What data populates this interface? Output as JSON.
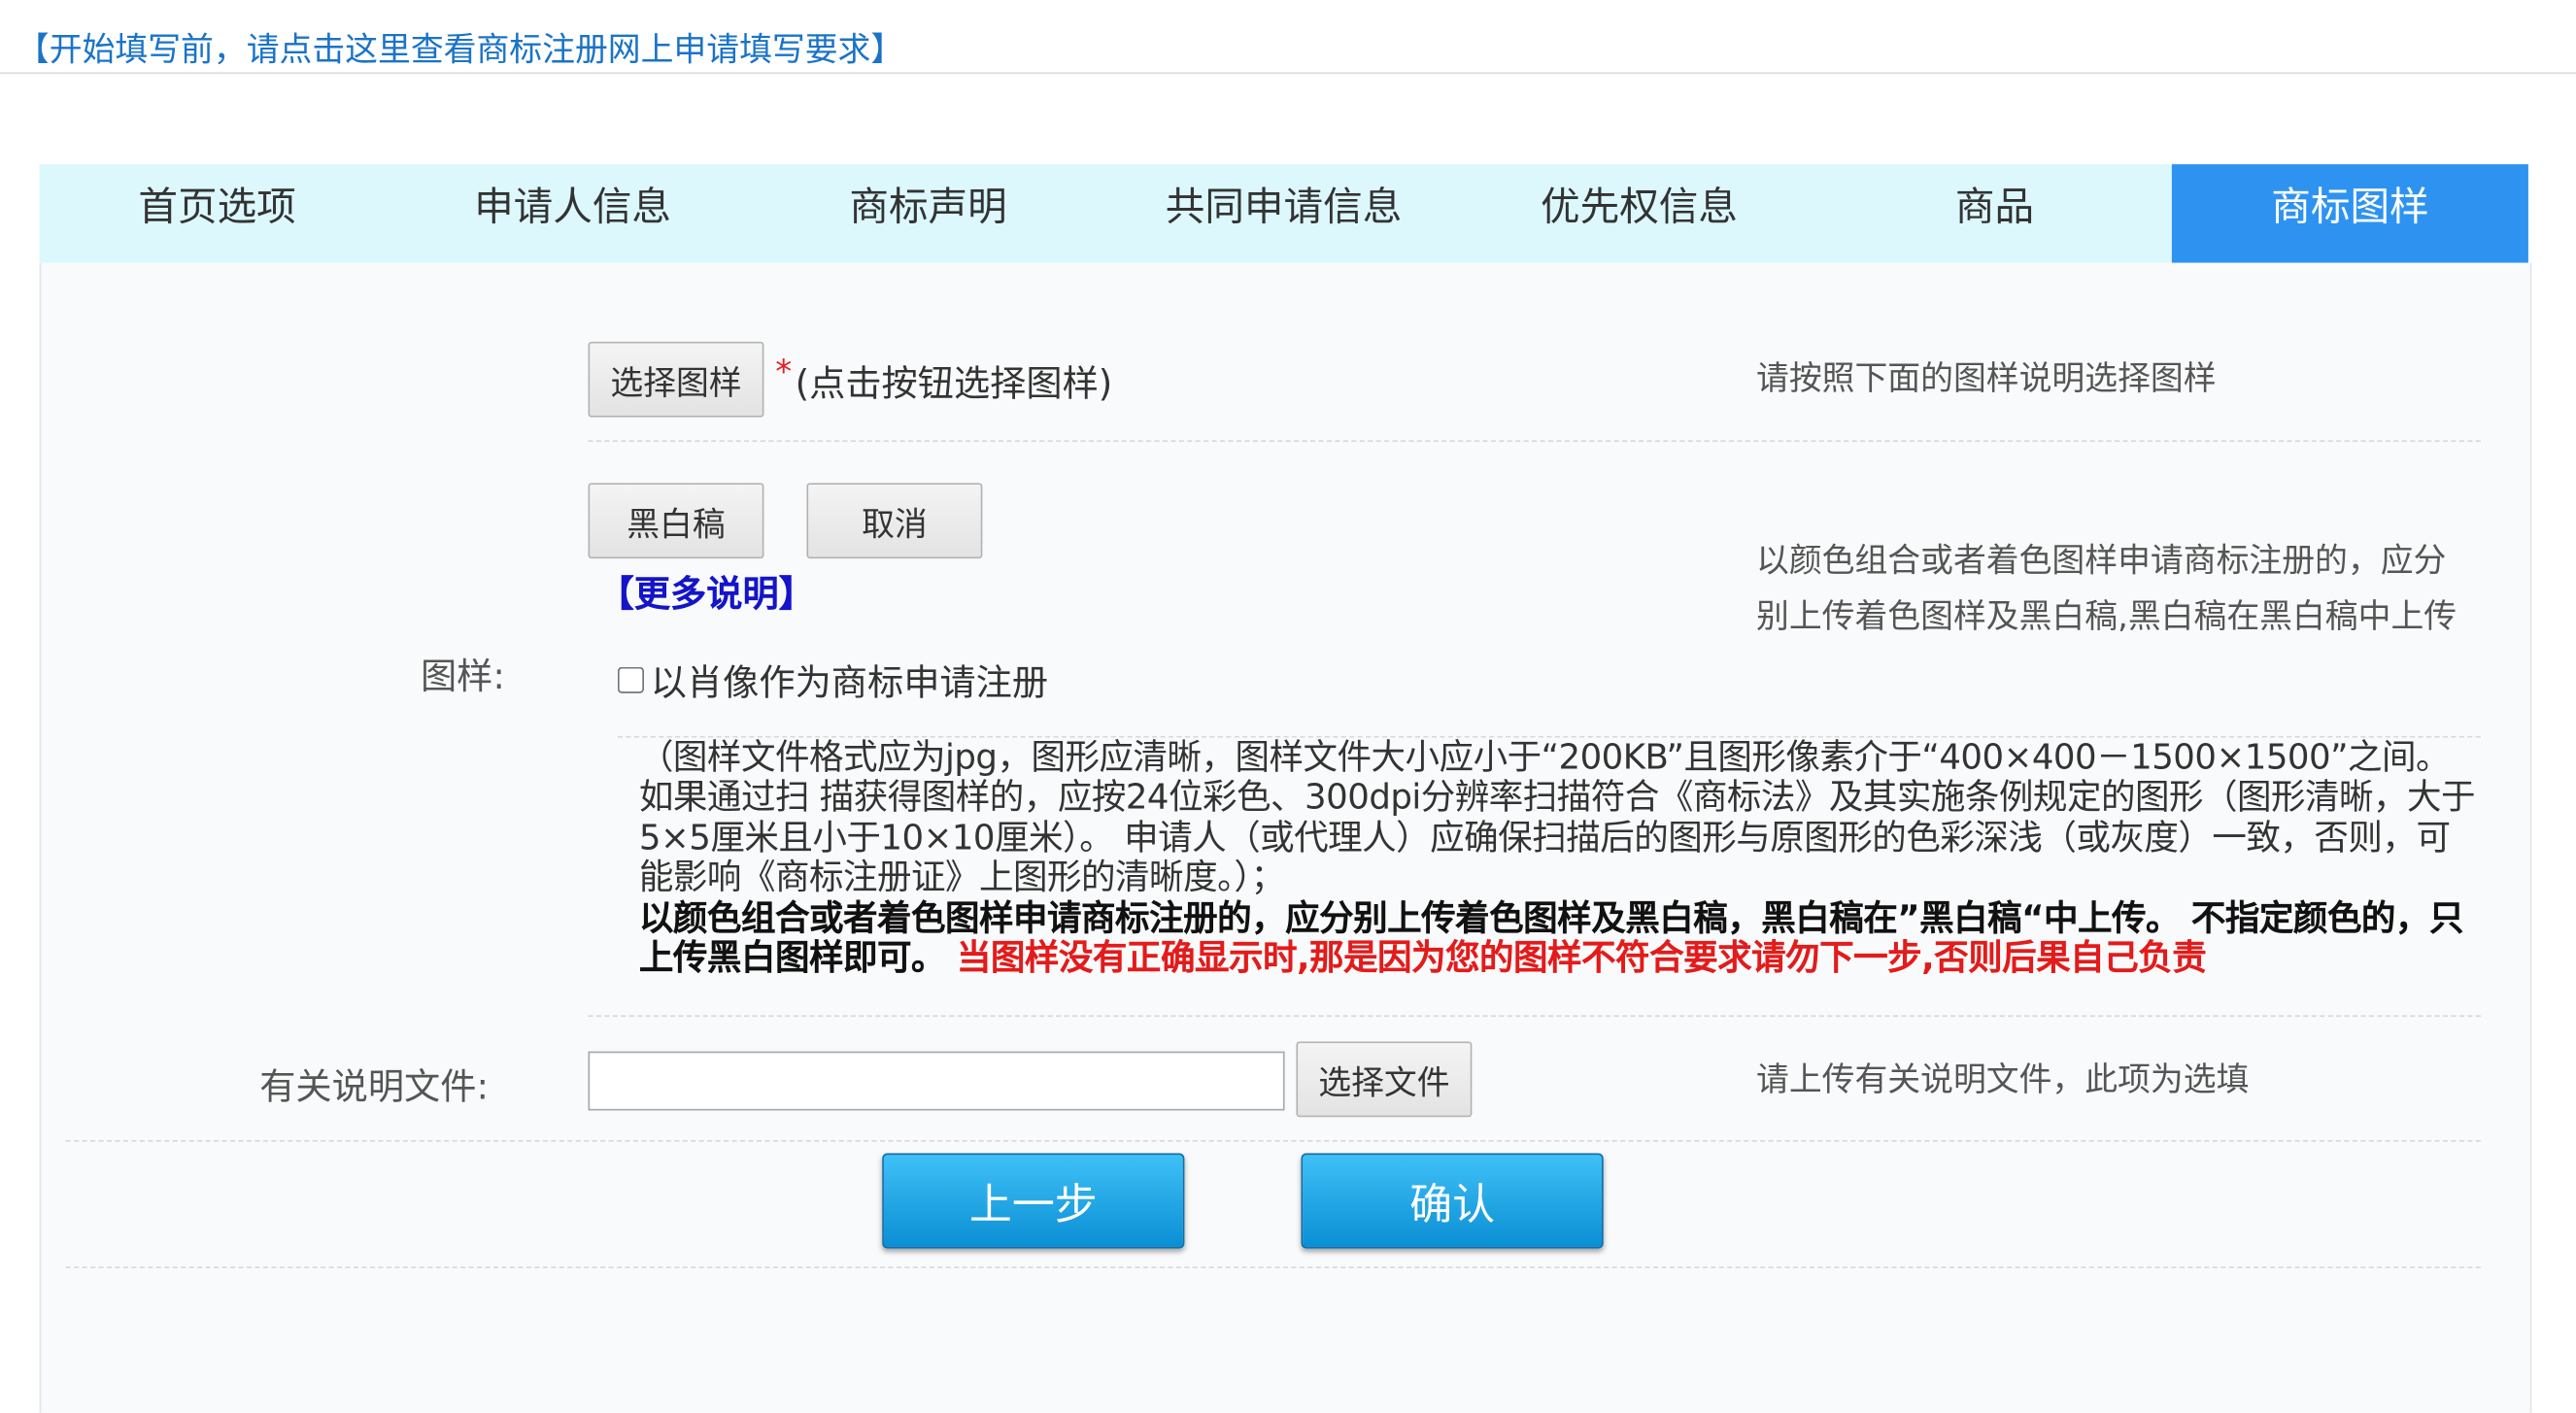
{
  "notice": {
    "text": "【开始填写前，请点击这里查看商标注册网上申请填写要求】"
  },
  "tabs": [
    {
      "label": "首页选项",
      "active": false
    },
    {
      "label": "申请人信息",
      "active": false
    },
    {
      "label": "商标声明",
      "active": false
    },
    {
      "label": "共同申请信息",
      "active": false
    },
    {
      "label": "优先权信息",
      "active": false
    },
    {
      "label": "商品",
      "active": false
    },
    {
      "label": "商标图样",
      "active": true
    }
  ],
  "image_section": {
    "choose_button": "选择图样",
    "required_mark": "*",
    "choose_hint": "(点击按钮选择图样)",
    "right_hint": "请按照下面的图样说明选择图样",
    "bw_button": "黑白稿",
    "cancel_button": "取消",
    "more_link": "【更多说明】",
    "color_hint_line1": "以颜色组合或者着色图样申请商标注册的，应分",
    "color_hint_line2": "别上传着色图样及黑白稿,黑白稿在黑白稿中上传",
    "label": "图样:",
    "portrait_checkbox_label": "以肖像作为商标申请注册",
    "portrait_checked": false,
    "description_normal": "（图样文件格式应为jpg，图形应清晰，图样文件大小应小于“200KB”且图形像素介于“400×400－1500×1500”之间。如果通过扫 描获得图样的，应按24位彩色、300dpi分辨率扫描符合《商标法》及其实施条例规定的图形（图形清晰，大于5×5厘米且小于10×10厘米）。 申请人（或代理人）应确保扫描后的图形与原图形的色彩深浅（或灰度）一致，否则，可能影响《商标注册证》上图形的清晰度。）；",
    "description_bold": "以颜色组合或者着色图样申请商标注册的，应分别上传着色图样及黑白稿，黑白稿在”黑白稿“中上传。 不指定颜色的，只上传黑白图样即可。",
    "description_warning": " 当图样没有正确显示时,那是因为您的图样不符合要求请勿下一步,否则后果自己负责"
  },
  "file_section": {
    "label": "有关说明文件:",
    "input_value": "",
    "choose_file_button": "选择文件",
    "right_hint": "请上传有关说明文件，此项为选填"
  },
  "actions": {
    "prev_button": "上一步",
    "confirm_button": "确认"
  },
  "colors": {
    "notice_link": "#1a73c8",
    "tab_bar_bg": "#dcf8fd",
    "tab_active_bg": "#2e93f0",
    "more_link": "#1414c8",
    "warning": "#e31b1b",
    "primary_button": "#0b8fd4"
  }
}
